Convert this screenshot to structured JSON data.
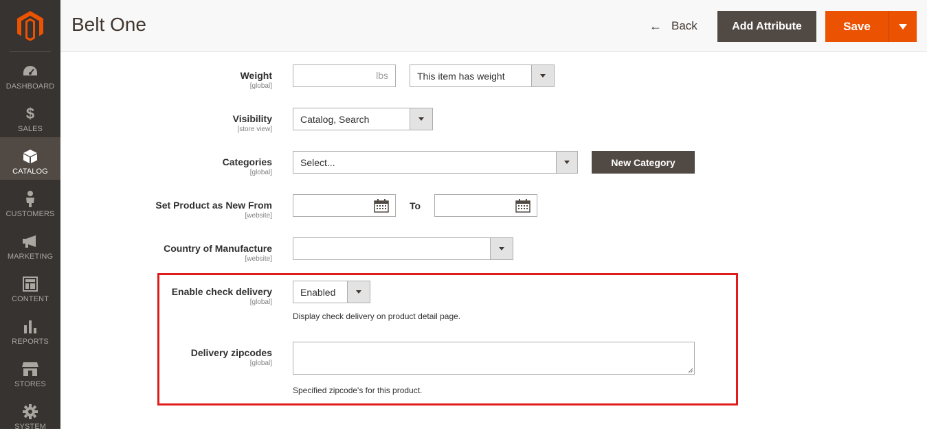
{
  "sidebar": {
    "items": [
      {
        "label": "DASHBOARD",
        "icon": "dashboard-icon"
      },
      {
        "label": "SALES",
        "icon": "dollar-icon"
      },
      {
        "label": "CATALOG",
        "icon": "box-icon",
        "active": true
      },
      {
        "label": "CUSTOMERS",
        "icon": "person-icon"
      },
      {
        "label": "MARKETING",
        "icon": "megaphone-icon"
      },
      {
        "label": "CONTENT",
        "icon": "layout-icon"
      },
      {
        "label": "REPORTS",
        "icon": "bar-chart-icon"
      },
      {
        "label": "STORES",
        "icon": "store-icon"
      },
      {
        "label": "SYSTEM",
        "icon": "gear-icon"
      }
    ]
  },
  "header": {
    "title": "Belt One",
    "back_label": "Back",
    "add_attribute_label": "Add Attribute",
    "save_label": "Save"
  },
  "form": {
    "weight": {
      "label": "Weight",
      "scope": "[global]",
      "unit": "lbs",
      "value": "",
      "select_value": "This item has weight"
    },
    "visibility": {
      "label": "Visibility",
      "scope": "[store view]",
      "value": "Catalog, Search"
    },
    "categories": {
      "label": "Categories",
      "scope": "[global]",
      "placeholder": "Select...",
      "new_category_label": "New Category"
    },
    "new_from": {
      "label": "Set Product as New From",
      "scope": "[website]",
      "to_label": "To",
      "from_value": "",
      "to_value": ""
    },
    "country": {
      "label": "Country of Manufacture",
      "scope": "[website]",
      "value": ""
    },
    "check_delivery": {
      "label": "Enable check delivery",
      "scope": "[global]",
      "value": "Enabled",
      "note": "Display check delivery on product detail page."
    },
    "zipcodes": {
      "label": "Delivery zipcodes",
      "scope": "[global]",
      "value": "",
      "note": "Specified zipcode's for this product."
    }
  },
  "colors": {
    "sidebar_bg": "#373330",
    "active_nav_bg": "#514943",
    "save_orange": "#eb5202",
    "dark_button": "#514943",
    "highlight_red": "#e01b1b"
  }
}
